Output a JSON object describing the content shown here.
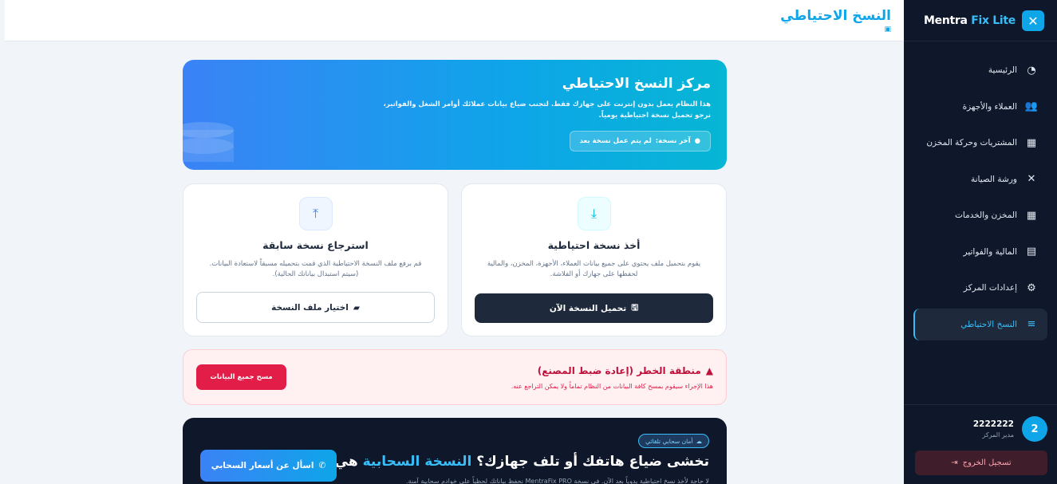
{
  "brand": {
    "name_part1": "Mentra ",
    "name_part2": "Fix Lite",
    "logo_icon": "wrench-cross-icon",
    "accent": "#0ea5e9"
  },
  "header": {
    "title": "النسخ الاحتياطي",
    "title_icon": "database-icon"
  },
  "sidebar": {
    "items": [
      {
        "label": "الرئيسية",
        "icon": "pie-chart-icon"
      },
      {
        "label": "العملاء والأجهزة",
        "icon": "users-icon"
      },
      {
        "label": "المشتريات وحركة المخزن",
        "icon": "boxes-icon"
      },
      {
        "label": "ورشة الصيانة",
        "icon": "tools-icon"
      },
      {
        "label": "المخزن والخدمات",
        "icon": "boxes-icon"
      },
      {
        "label": "المالية والفواتير",
        "icon": "invoice-icon"
      },
      {
        "label": "إعدادات المركز",
        "icon": "gear-icon"
      },
      {
        "label": "النسخ الاحتياطي",
        "icon": "database-icon",
        "active": true
      }
    ],
    "user": {
      "initial": "2",
      "name": "2222222",
      "role": "مدير المركز"
    },
    "logout_label": "تسجيل الخروج"
  },
  "hero": {
    "title": "مركز النسخ الاحتياطي",
    "description": "هذا النظام يعمل بدون إنترنت على جهازك فقط. لتجنب ضياع بيانات عملائك أوامر الشغل والفواتير، نرجو تحميل نسخة احتياطية يومياً.",
    "last_backup_label": "آخر نسخة:",
    "last_backup_value": "لم يتم عمل نسخة بعد"
  },
  "backup_card": {
    "title": "أخذ نسخة احتياطية",
    "description": "يقوم بتحميل ملف يحتوي على جميع بيانات العملاء، الأجهزة، المخزن، والمالية لحفظها على جهازك أو الفلاشة.",
    "button_label": "تحميل النسخة الآن"
  },
  "restore_card": {
    "title": "استرجاع نسخة سابقة",
    "description": "قم برفع ملف النسخة الاحتياطية الذي قمت بتحميله مسبقاً لاستعادة البيانات. (سيتم استبدال بياناتك الحالية).",
    "button_label": "اختيار ملف النسخة"
  },
  "danger_zone": {
    "title": "منطقة الخطر (إعادة ضبط المصنع)",
    "description": "هذا الإجراء سيقوم بمسح كافة البيانات من النظام تماماً ولا يمكن التراجع عنه.",
    "button_label": "مسح جميع البيانات",
    "color": "#e11d48"
  },
  "promo": {
    "badge": "أمان سحابي تلقائي",
    "title_part1": "تخشى ضياع هاتفك أو تلف جهازك؟ ",
    "title_highlight": "النسخة السحابية",
    "title_part2": " هي الحل!",
    "description": "لا حاجة لأخذ نسخ احتياطية يدوياً بعد الآن. في نسخة MentraFix PRO نحفظ بياناتك لحظياً على خوادم سحابية آمنة.",
    "button_label": "اسأل عن أسعار السحابي"
  }
}
